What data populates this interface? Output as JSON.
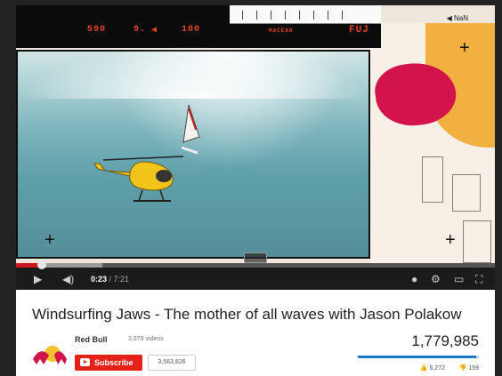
{
  "player": {
    "film_digits_1": "590",
    "film_digits_2": "9.",
    "film_digits_3": "100",
    "film_label": "MACEAN",
    "film_brand": "FUJ",
    "nan_label": "NaN",
    "time_current": "0:23",
    "time_total": "7:21",
    "progress_played": 0.053,
    "progress_loaded": 0.18
  },
  "video": {
    "title": "Windsurfing Jaws - The mother of all waves with Jason Polakow",
    "views": "1,779,985",
    "likes": "6,272",
    "dislikes": "159",
    "like_ratio": 0.975
  },
  "channel": {
    "name": "Red Bull",
    "video_count": "3,979 videos",
    "subscribe_label": "Subscribe",
    "subscriber_count": "3,563,826"
  },
  "icons": {
    "play": "play-icon",
    "next": "next-icon",
    "volume": "volume-icon",
    "annotations": "annotations-icon",
    "settings": "gear-icon",
    "size": "theater-mode-icon",
    "fullscreen": "fullscreen-icon",
    "like": "thumbs-up-icon",
    "dislike": "thumbs-down-icon"
  },
  "colors": {
    "subscribe_red": "#e62117",
    "progress_red": "#cc181e",
    "like_blue": "#167ac6"
  }
}
